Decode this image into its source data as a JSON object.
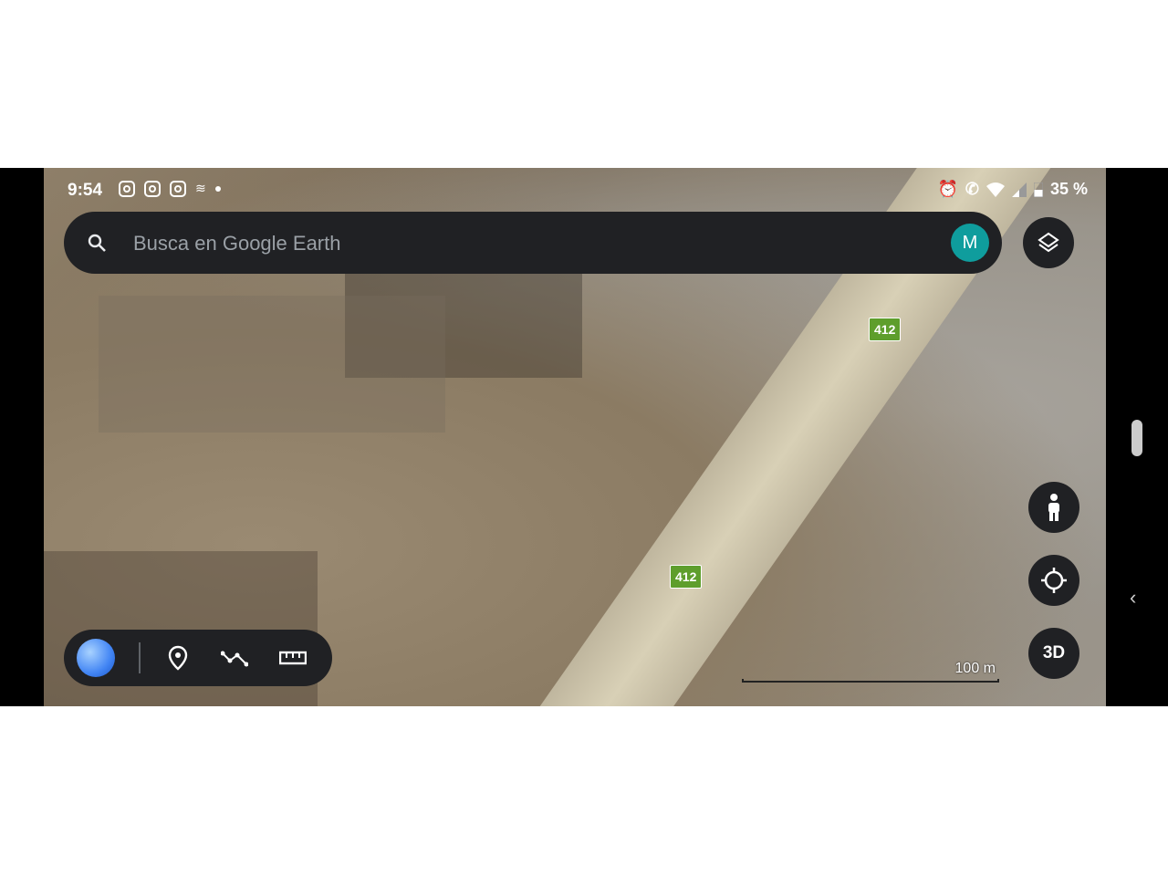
{
  "status_bar": {
    "time": "9:54",
    "battery": "35 %",
    "left_icons": [
      "instagram-icon",
      "instagram-icon",
      "instagram-icon",
      "notification-icon",
      "dot-icon"
    ],
    "right_icons": [
      "alarm-icon",
      "call-icon",
      "wifi-icon",
      "signal-icon",
      "battery-icon"
    ]
  },
  "search": {
    "placeholder": "Busca en Google Earth",
    "avatar_letter": "M"
  },
  "map": {
    "route_label_1": "412",
    "route_label_2": "412",
    "scale_label": "100 m"
  },
  "controls": {
    "three_d_label": "3D"
  },
  "colors": {
    "panel": "#202124",
    "avatar": "#0f9d9d",
    "route_shield": "#5e9e2c"
  }
}
